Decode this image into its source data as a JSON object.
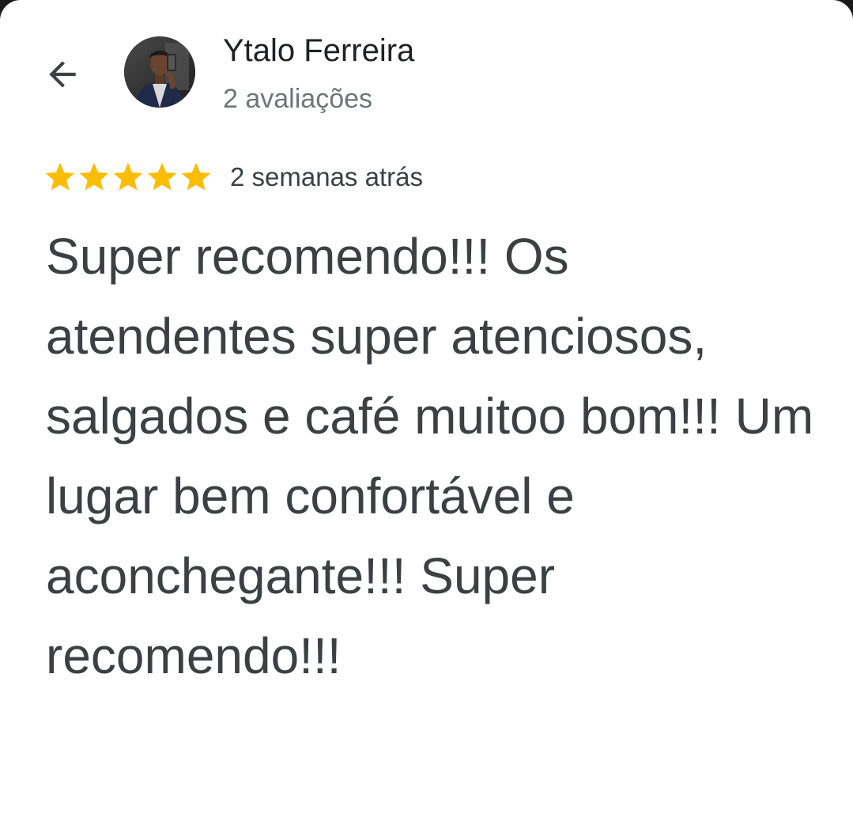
{
  "header": {
    "back_icon": "arrow-back-icon",
    "avatar_icon": "profile-photo"
  },
  "reviewer": {
    "name": "Ytalo Ferreira",
    "review_count": "2 avaliações"
  },
  "review": {
    "rating": 5,
    "rating_max": 5,
    "star_color": "#fbbc04",
    "date": "2 semanas atrás",
    "text": "Super recomendo!!! Os atendentes super atenciosos, salgados e café muitoo bom!!! Um lugar bem confortável e aconchegante!!! Super recomendo!!!"
  },
  "colors": {
    "background": "#ffffff",
    "primary_text": "#202124",
    "secondary_text": "#70757a",
    "body_text": "#3c4043"
  }
}
